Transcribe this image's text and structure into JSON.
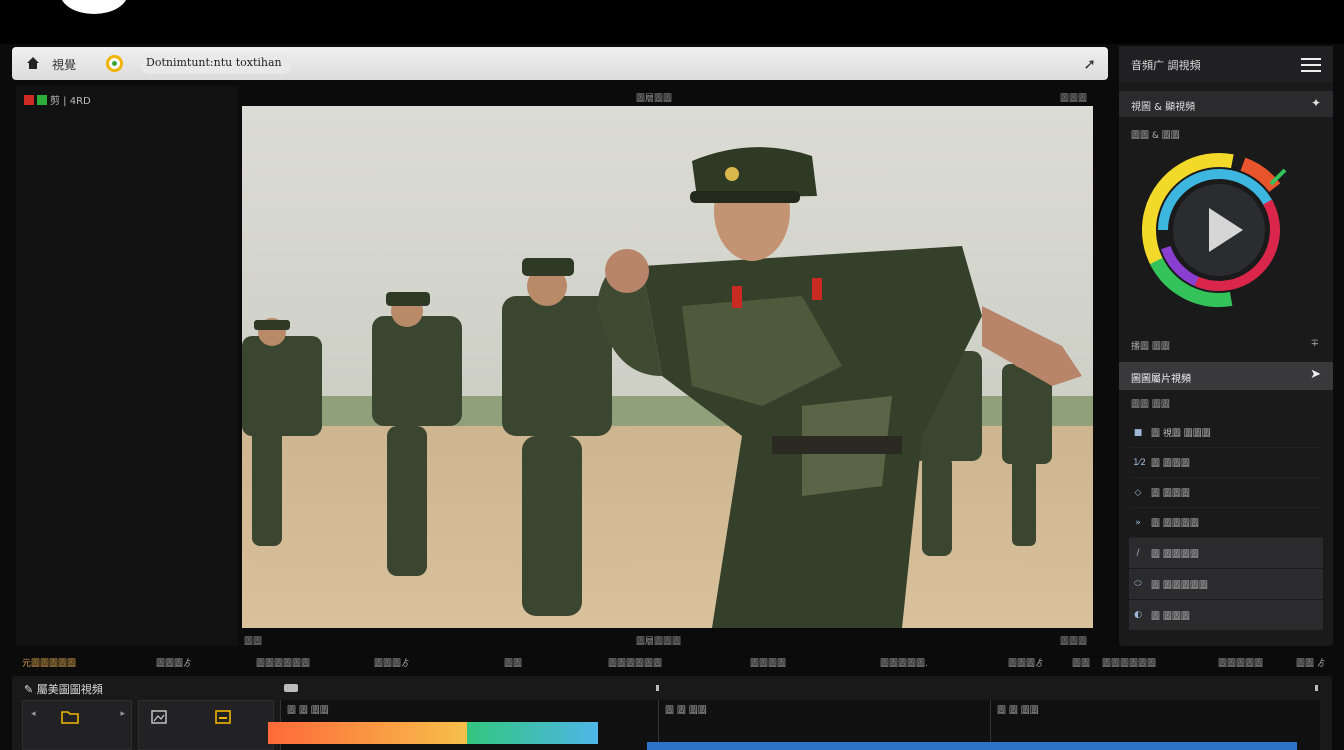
{
  "urlbar": {
    "title": "視覺",
    "address": "Dotnimtunt:ntu  toxtihan"
  },
  "left_panel": {
    "tag_label": "剪 | 4RD"
  },
  "preview": {
    "label_top": "圖層圖圖",
    "label_top_right": "圖圖圖",
    "label_bottom": "圖層圖圖圖",
    "label_bottom_left": "圖圖",
    "label_bottom_right": "圖圖圖"
  },
  "right_panel": {
    "header_title": "音頻广 調視頻",
    "section1_title": "視圖 & 顯視頻",
    "sub_label": "圖圖 & 圖圖",
    "label_a": "播圖 圖圖",
    "section2_title": "圖圖屬片視頻",
    "label_b": "圖圖 圖圖",
    "items": [
      {
        "icon": "■",
        "label": "圖 視圖 圖圖圖"
      },
      {
        "icon": "1⁄2",
        "label": "圖 圖圖圖"
      },
      {
        "icon": "◇",
        "label": "圖 圖圖圖"
      },
      {
        "icon": "»",
        "label": "圖 圖圖圖圖"
      },
      {
        "icon": "∕",
        "label": "圖 圖圖圖圖"
      },
      {
        "icon": "⬭",
        "label": "圖 圖圖圖圖圖"
      },
      {
        "icon": "◐",
        "label": "圖 圖圖圖"
      }
    ],
    "dial_colors": [
      "#f2d92a",
      "#3db7e0",
      "#e8542c",
      "#d9264a",
      "#8b3fd0",
      "#34c35a"
    ]
  },
  "label_row": [
    "元圖圖圖圖圖",
    "圖圖圖ゟ",
    "圖圖圖圖圖圖",
    "圖圖圖ゟ",
    "圖圖",
    "圖圖圖圖圖圖",
    "圖圖圖圖",
    "圖圖圖圖圖.",
    "圖圖圖ゟ",
    "圖圖",
    "圖圖圖圖圖圖",
    "圖圖圖圖圖",
    "圖圖 ゟ"
  ],
  "timeline": {
    "title": "屬美圖圖視頻",
    "track_labels": [
      "圖 圖 圖圖",
      "圖 圖 圖圖",
      "圖 圖 圖圖"
    ]
  }
}
